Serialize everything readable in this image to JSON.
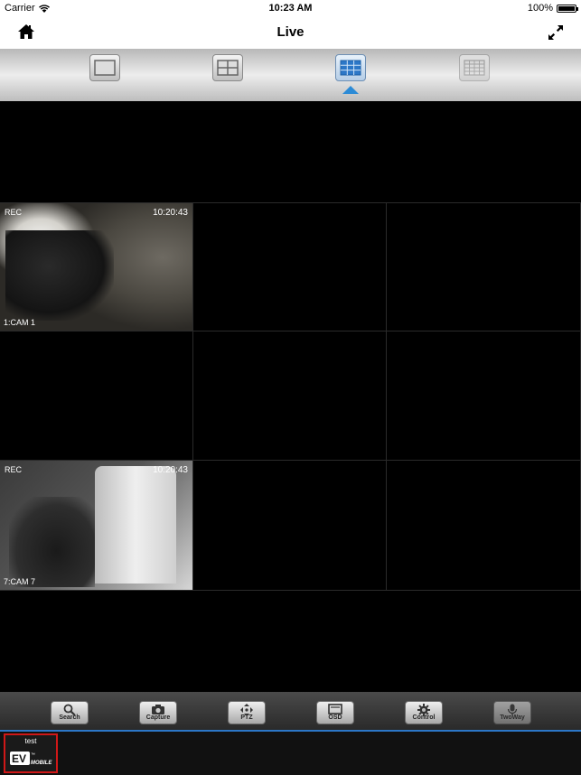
{
  "status_bar": {
    "carrier": "Carrier",
    "time": "10:23 AM",
    "battery": "100%"
  },
  "nav": {
    "title": "Live"
  },
  "layout_options": [
    {
      "name": "single",
      "active": false
    },
    {
      "name": "quad",
      "active": false
    },
    {
      "name": "nine",
      "active": true
    },
    {
      "name": "sixteen",
      "active": false
    }
  ],
  "cameras": [
    {
      "rec": "REC",
      "time": "10:20:43",
      "label": "1:CAM 1"
    },
    {
      "rec": "",
      "time": "",
      "label": ""
    },
    {
      "rec": "",
      "time": "",
      "label": ""
    },
    {
      "rec": "",
      "time": "",
      "label": ""
    },
    {
      "rec": "",
      "time": "",
      "label": ""
    },
    {
      "rec": "",
      "time": "",
      "label": ""
    },
    {
      "rec": "REC",
      "time": "10:20:43",
      "label": "7:CAM 7"
    },
    {
      "rec": "",
      "time": "",
      "label": ""
    },
    {
      "rec": "",
      "time": "",
      "label": ""
    }
  ],
  "toolbar": {
    "search": "Search",
    "capture": "Capture",
    "ptz": "PTZ",
    "osd": "OSD",
    "control": "Control",
    "twoway": "TwoWay"
  },
  "device": {
    "name": "test",
    "logo": "EV MOBILE"
  },
  "colors": {
    "accent": "#2c8bd6",
    "selected_border": "#d01818"
  }
}
